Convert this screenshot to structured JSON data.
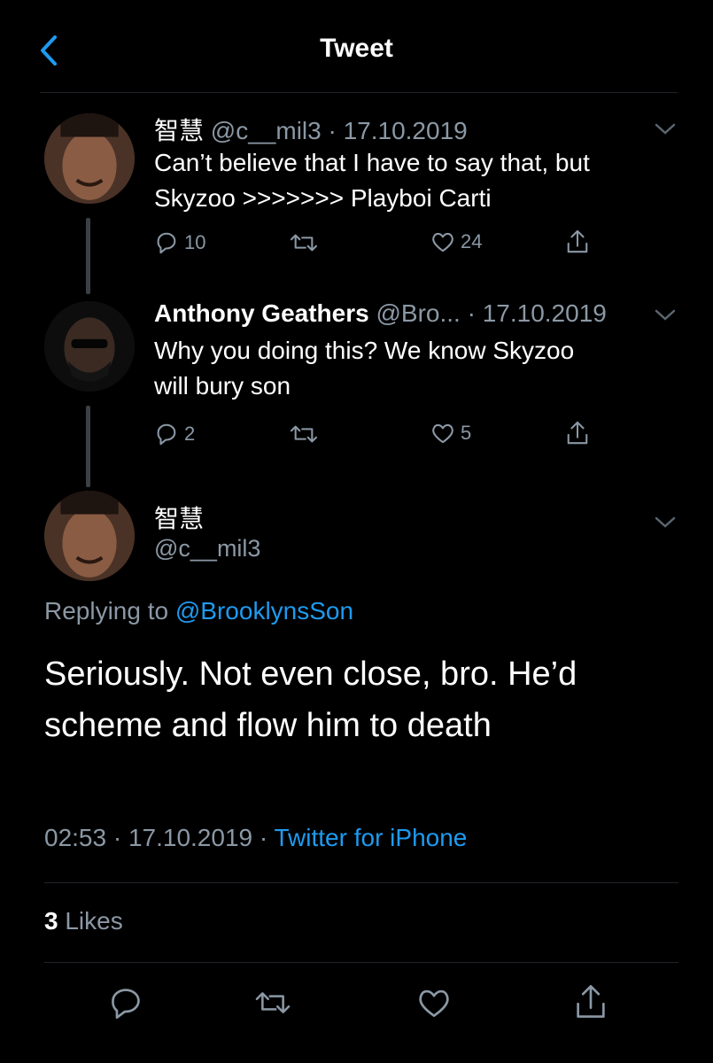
{
  "header": {
    "title": "Tweet"
  },
  "tweets": [
    {
      "display_name": "智慧",
      "handle": "@c__mil3",
      "date": "· 17.10.2019",
      "text_lines": [
        "Can’t believe that I have to say that, but",
        "Skyzoo >>>>>>> Playboi Carti"
      ],
      "replies": "10",
      "likes": "24"
    },
    {
      "display_name": "Anthony Geathers",
      "handle": "@Bro...",
      "date": "· 17.10.2019",
      "text_lines": [
        "Why you doing this? We know Skyzoo",
        "will bury son"
      ],
      "replies": "2",
      "likes": "5"
    }
  ],
  "main_tweet": {
    "display_name": "智慧",
    "handle": "@c__mil3",
    "replying_prefix": "Replying to",
    "replying_handle": "@BrooklynsSon",
    "text_lines": [
      "Seriously. Not even close, bro. He’d",
      "scheme and flow him to death"
    ],
    "time": "02:53",
    "date": "· 17.10.2019 ·",
    "source": "Twitter for iPhone",
    "likes_count": "3",
    "likes_label": "Likes"
  },
  "colors": {
    "accent": "#1d9bf0",
    "muted": "#8b98a5",
    "background": "#000000"
  }
}
